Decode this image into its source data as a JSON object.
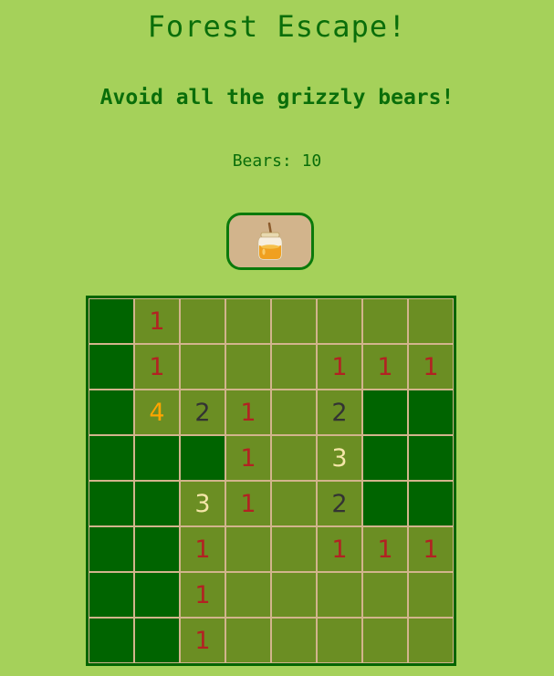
{
  "header": {
    "title": "Forest Escape!",
    "subtitle": "Avoid all the grizzly bears!",
    "bears_label": "Bears: ",
    "bears_count": "10"
  },
  "colors": {
    "background": "#a5d15a",
    "text": "#0a6e0a",
    "covered_cell": "#006400",
    "open_cell": "#6b8e23",
    "cell_border": "#d2b48c",
    "button_bg": "#d2b48c",
    "button_border": "#0b7a0b"
  },
  "honey_button": {
    "icon": "honey-jar-icon"
  },
  "number_colors": {
    "1": "#b22222",
    "2": "#333333",
    "3": "#f5e6a8",
    "4": "#ffa500"
  },
  "board": {
    "rows": 8,
    "cols": 8,
    "cells": [
      [
        "#",
        "1",
        "",
        "",
        "",
        "",
        "",
        ""
      ],
      [
        "#",
        "1",
        "",
        "",
        "",
        "1",
        "1",
        "1"
      ],
      [
        "#",
        "4",
        "2",
        "1",
        "",
        "2",
        "#",
        "#"
      ],
      [
        "#",
        "#",
        "#",
        "1",
        "",
        "3",
        "#",
        "#"
      ],
      [
        "#",
        "#",
        "3",
        "1",
        "",
        "2",
        "#",
        "#"
      ],
      [
        "#",
        "#",
        "1",
        "",
        "",
        "1",
        "1",
        "1"
      ],
      [
        "#",
        "#",
        "1",
        "",
        "",
        "",
        "",
        ""
      ],
      [
        "#",
        "#",
        "1",
        "",
        "",
        "",
        "",
        ""
      ]
    ]
  }
}
